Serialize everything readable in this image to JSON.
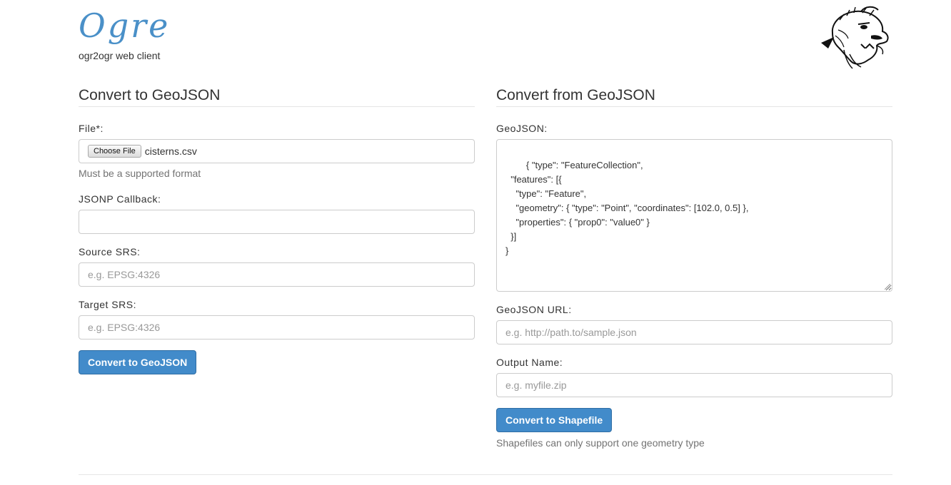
{
  "brand": {
    "title": "Ogre",
    "subtitle": "ogr2ogr web client",
    "mascot_icon": "ogre-mascot-icon"
  },
  "to_geojson": {
    "heading": "Convert to GeoJSON",
    "file_label": "File*:",
    "file_button": "Choose File",
    "file_name": "cisterns.csv",
    "file_help": "Must be a supported format",
    "callback_label": "JSONP Callback:",
    "callback_value": "",
    "source_srs_label": "Source SRS:",
    "source_srs_placeholder": "e.g. EPSG:4326",
    "target_srs_label": "Target SRS:",
    "target_srs_placeholder": "e.g. EPSG:4326",
    "submit_label": "Convert to GeoJSON"
  },
  "from_geojson": {
    "heading": "Convert from GeoJSON",
    "geojson_label": "GeoJSON:",
    "geojson_value": "{ \"type\": \"FeatureCollection\",\n  \"features\": [{\n    \"type\": \"Feature\",\n    \"geometry\": { \"type\": \"Point\", \"coordinates\": [102.0, 0.5] },\n    \"properties\": { \"prop0\": \"value0\" }\n  }]\n}",
    "url_label": "GeoJSON URL:",
    "url_placeholder": "e.g. http://path.to/sample.json",
    "output_label": "Output Name:",
    "output_placeholder": "e.g. myfile.zip",
    "submit_label": "Convert to Shapefile",
    "submit_help": "Shapefiles can only support one geometry type"
  },
  "colors": {
    "accent": "#428bca",
    "brand": "#4a90c8",
    "border": "#cccccc",
    "help_text": "#737373"
  }
}
